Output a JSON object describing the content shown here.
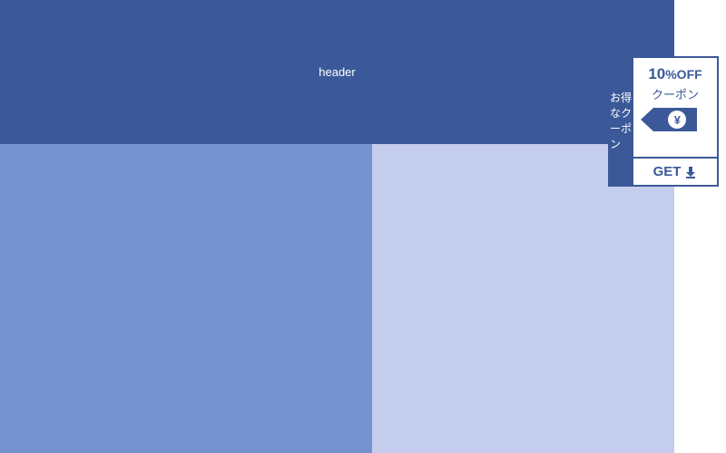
{
  "header": {
    "title": "header"
  },
  "coupon": {
    "tab_label": "お得なクーポン",
    "discount_number": "10",
    "discount_suffix": "%OFF",
    "coupon_label": "クーポン",
    "currency_symbol": "¥",
    "action_label": "GET"
  },
  "colors": {
    "primary": "#3b5998",
    "content_left": "#7593cf",
    "content_right": "#c5cdef"
  }
}
